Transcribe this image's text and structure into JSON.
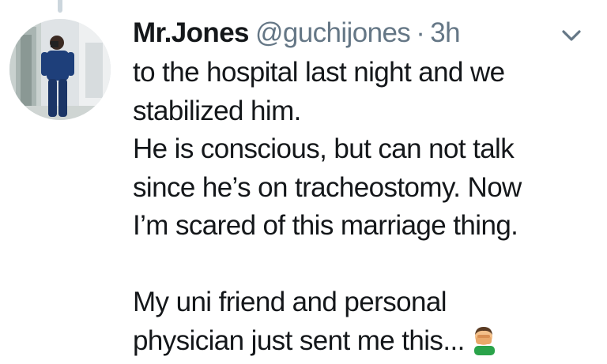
{
  "tweet": {
    "author": {
      "display_name": "Mr.Jones",
      "handle": "@guchijones"
    },
    "separator": "·",
    "timestamp": "3h",
    "body_lines": [
      "to the hospital last night and we",
      "stabilized him.",
      "He is conscious, but can not talk",
      "since he’s on tracheostomy. Now",
      "I’m scared of this marriage thing.",
      "",
      "My uni friend and personal",
      "physician just sent me this..."
    ],
    "emoji": "man-facepalming-emoji"
  },
  "icons": {
    "caret": "chevron-down-icon",
    "avatar": "avatar"
  },
  "colors": {
    "text_primary": "#14171a",
    "text_secondary": "#657786",
    "thread_line": "#ccd6dd"
  }
}
